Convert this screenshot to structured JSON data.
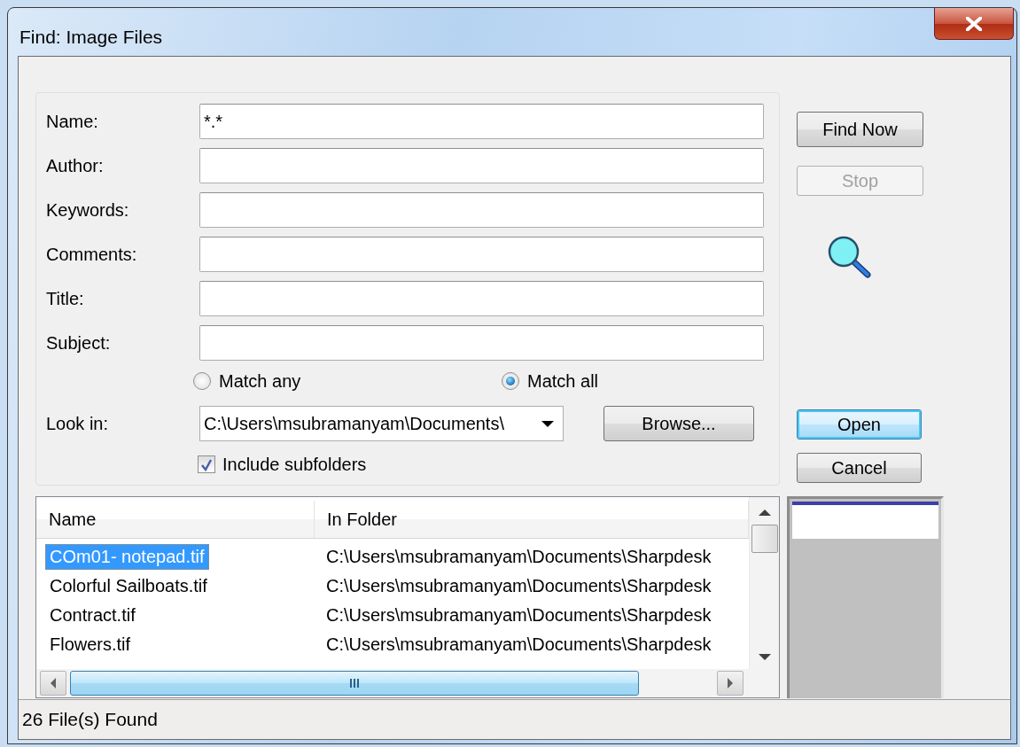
{
  "window": {
    "title": "Find: Image Files"
  },
  "criteria": {
    "fields": [
      {
        "label": "Name:",
        "value": "*.*"
      },
      {
        "label": "Author:"
      },
      {
        "label": "Keywords:"
      },
      {
        "label": "Comments:"
      },
      {
        "label": "Title:"
      },
      {
        "label": "Subject:"
      }
    ],
    "match_options": [
      {
        "label": "Match any",
        "selected": false
      },
      {
        "label": "Match all",
        "selected": true
      }
    ],
    "look_in": {
      "label": "Look in:",
      "value": "C:\\Users\\msubramanyam\\Documents\\"
    },
    "browse_button": {
      "label": "Browse..."
    },
    "include_subfolders": {
      "label": "Include subfolders",
      "checked": true
    }
  },
  "actions": [
    {
      "label": "Find Now",
      "disabled": false
    },
    {
      "label": "Stop",
      "disabled": true
    }
  ],
  "dialog_buttons": [
    {
      "label": "Open",
      "default": true
    },
    {
      "label": "Cancel",
      "default": false
    }
  ],
  "results": {
    "columns": [
      "Name",
      "In Folder"
    ],
    "rows": [
      {
        "name": "COm01- notepad.tif",
        "folder": "C:\\Users\\msubramanyam\\Documents\\Sharpdesk",
        "selected": true
      },
      {
        "name": "Colorful Sailboats.tif",
        "folder": "C:\\Users\\msubramanyam\\Documents\\Sharpdesk",
        "selected": false
      },
      {
        "name": "Contract.tif",
        "folder": "C:\\Users\\msubramanyam\\Documents\\Sharpdesk",
        "selected": false
      },
      {
        "name": "Flowers.tif",
        "folder": "C:\\Users\\msubramanyam\\Documents\\Sharpdesk",
        "selected": false
      }
    ]
  },
  "status_bar": {
    "text": "26 File(s) Found"
  }
}
